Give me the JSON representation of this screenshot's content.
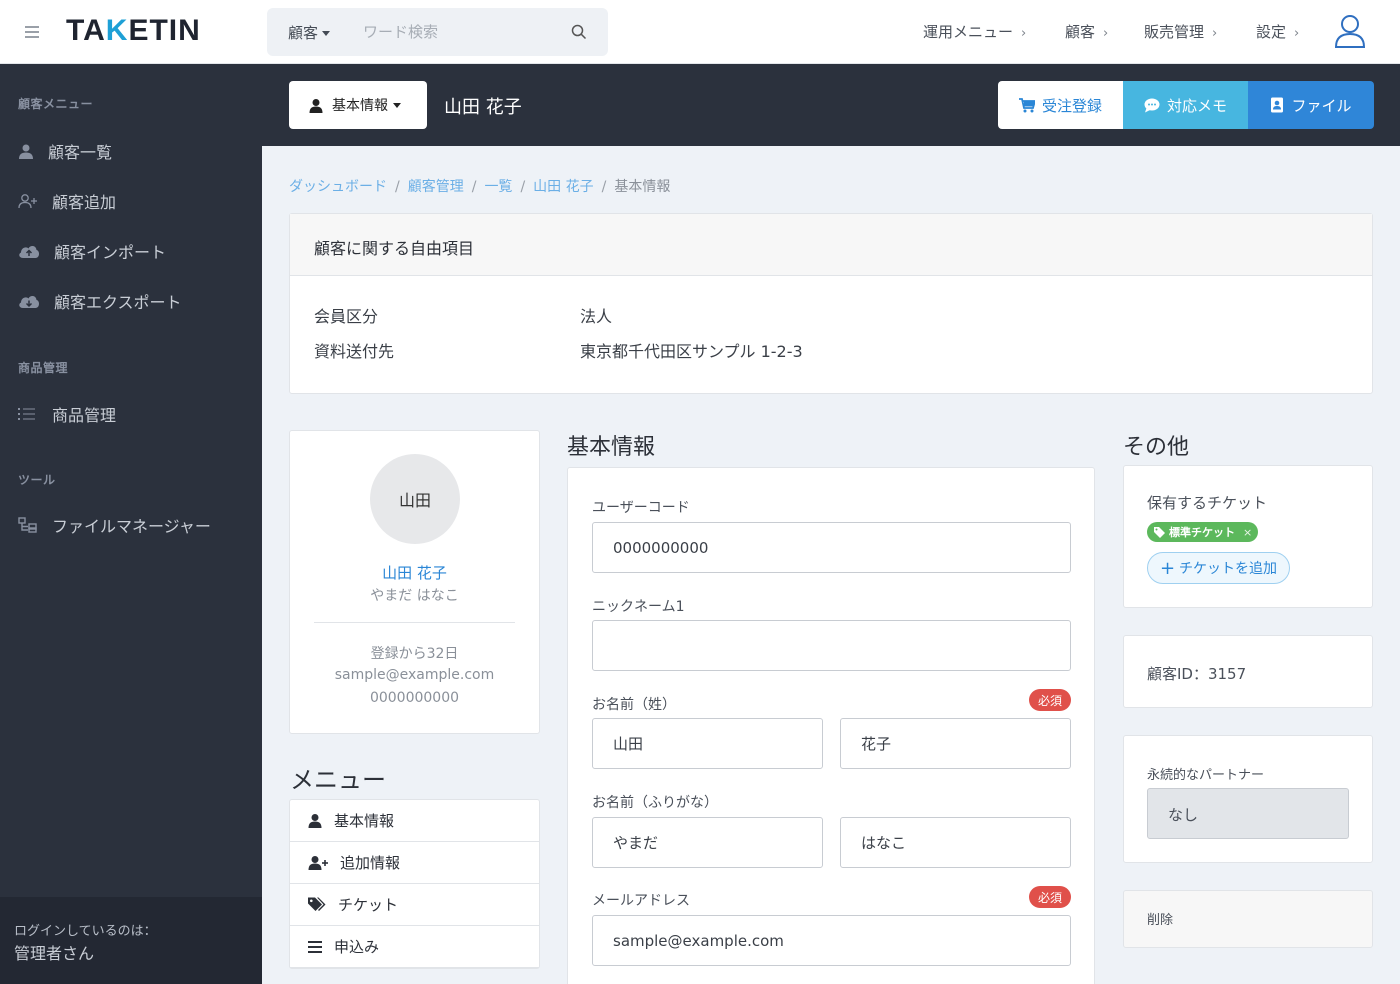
{
  "header": {
    "logo_text": "TAKETIN",
    "search_scope": "顧客",
    "search_placeholder": "ワード検索",
    "nav": [
      "運用メニュー",
      "顧客",
      "販売管理",
      "設定"
    ]
  },
  "sidebar": {
    "sections": [
      {
        "title": "顧客メニュー",
        "items": [
          "顧客一覧",
          "顧客追加",
          "顧客インポート",
          "顧客エクスポート"
        ]
      },
      {
        "title": "商品管理",
        "items": [
          "商品管理"
        ]
      },
      {
        "title": "ツール",
        "items": [
          "ファイルマネージャー"
        ]
      }
    ],
    "login_label": "ログインしているのは：",
    "login_name": "管理者さん"
  },
  "page_header": {
    "dropdown_label": "基本情報",
    "customer_name": "山田 花子",
    "buttons": {
      "order": "受注登録",
      "memo": "対応メモ",
      "file": "ファイル"
    }
  },
  "breadcrumb": [
    "ダッシュボード",
    "顧客管理",
    "一覧",
    "山田 花子",
    "基本情報"
  ],
  "free_fields": {
    "title": "顧客に関する自由項目",
    "rows": [
      {
        "label": "会員区分",
        "value": "法人"
      },
      {
        "label": "資料送付先",
        "value": "東京都千代田区サンプル 1-2-3"
      }
    ]
  },
  "profile": {
    "avatar_text": "山田",
    "name": "山田 花子",
    "kana": "やまだ はなこ",
    "registered": "登録から32日",
    "email": "sample@example.com",
    "phone": "0000000000"
  },
  "menu": {
    "title": "メニュー",
    "items": [
      "基本情報",
      "追加情報",
      "チケット",
      "申込み"
    ]
  },
  "basic_info": {
    "title": "基本情報",
    "required_badge": "必須",
    "user_code_label": "ユーザーコード",
    "user_code": "0000000000",
    "nickname_label": "ニックネーム1",
    "nickname": "",
    "name_label": "お名前（姓）",
    "last_name": "山田",
    "first_name": "花子",
    "kana_label": "お名前（ふりがな）",
    "last_kana": "やまだ",
    "first_kana": "はなこ",
    "email_label": "メールアドレス",
    "email": "sample@example.com"
  },
  "other": {
    "title": "その他",
    "tickets_label": "保有するチケット",
    "ticket_tag": "標準チケット",
    "ticket_remove": "×",
    "add_ticket": "チケットを追加",
    "customer_id": "顧客ID：3157",
    "partner_label": "永続的なパートナー",
    "partner_value": "なし",
    "delete_label": "削除"
  }
}
